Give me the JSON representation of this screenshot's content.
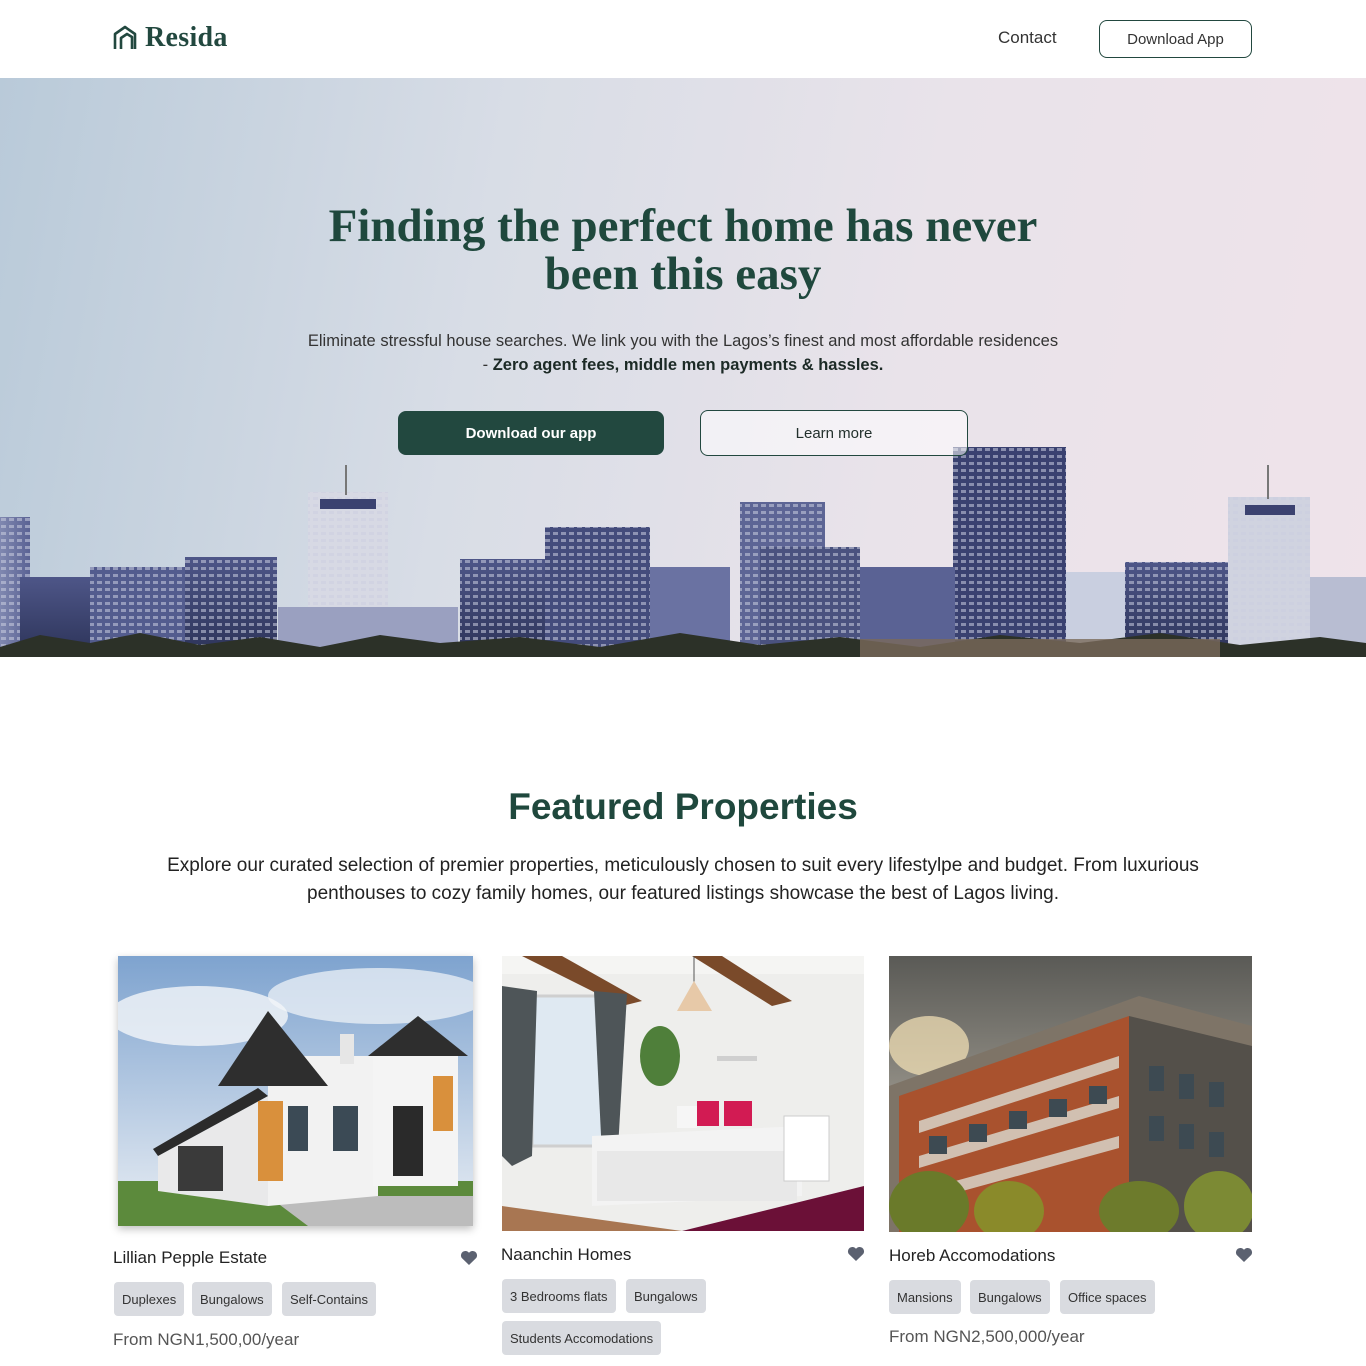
{
  "nav": {
    "brand": "Resida",
    "contact_label": "Contact",
    "download_label": "Download App"
  },
  "hero": {
    "title": "Finding the perfect home has never been this easy",
    "subtitle_plain": "Eliminate stressful house searches. We link you with the Lagos’s finest and most affordable residences - ",
    "subtitle_bold": "Zero agent fees, middle men payments & hassles.",
    "primary_cta": "Download our app",
    "secondary_cta": "Learn more"
  },
  "featured": {
    "title": "Featured Properties",
    "subtitle": "Explore our curated selection of premier properties, meticulously chosen to suit every lifestylpe and budget. From luxurious penthouses to cozy family homes, our featured listings showcase the best of Lagos living.",
    "properties": [
      {
        "name": "Lillian Pepple Estate",
        "tags": [
          "Duplexes",
          "Bungalows",
          "Self-Contains"
        ],
        "price": "From NGN1,500,00/year",
        "favorite_icon": "heart-icon"
      },
      {
        "name": "Naanchin Homes",
        "tags": [
          "3 Bedrooms flats",
          "Bungalows",
          "Students Accomodations"
        ],
        "price": "",
        "favorite_icon": "heart-icon"
      },
      {
        "name": "Horeb Accomodations",
        "tags": [
          "Mansions",
          "Bungalows",
          "Office spaces"
        ],
        "price": "From NGN2,500,000/year",
        "favorite_icon": "heart-icon"
      }
    ]
  },
  "colors": {
    "brand_green": "#22483f",
    "heading_green": "#1f483d",
    "tag_bg": "#d9dbe0",
    "heart": "#5b6170"
  }
}
